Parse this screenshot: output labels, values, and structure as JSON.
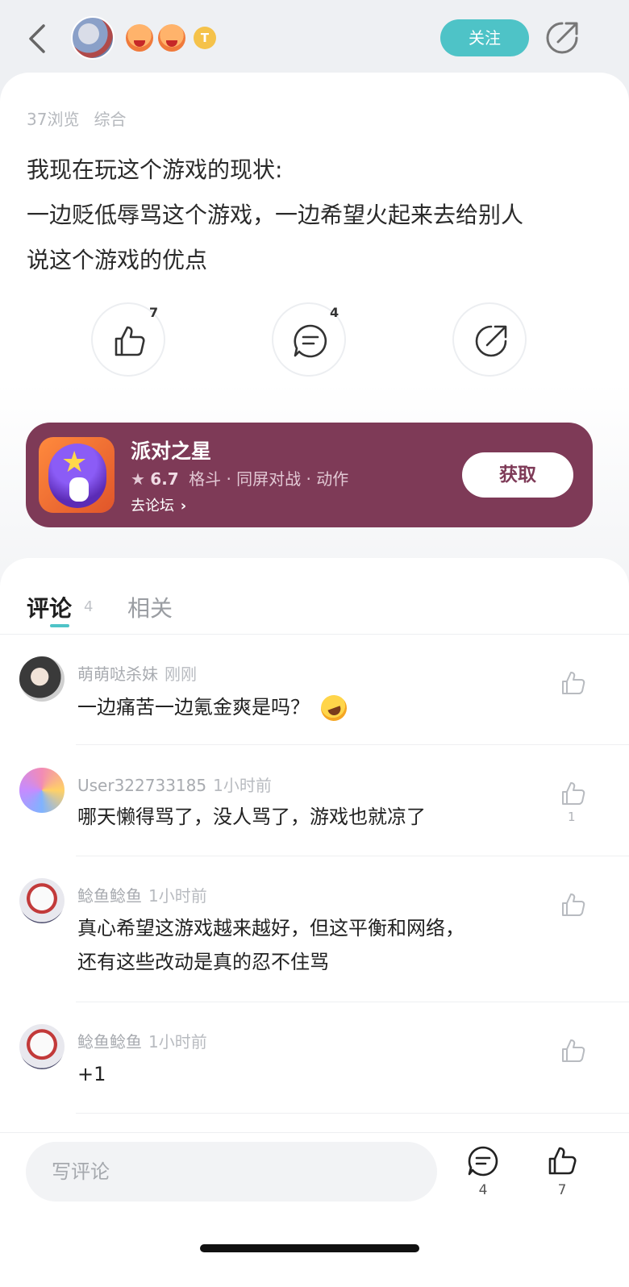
{
  "header": {
    "follow_label": "关注",
    "badge_letter": "T"
  },
  "post": {
    "views": "37浏览",
    "category": "综合",
    "lines": [
      "我现在玩这个游戏的现状:",
      "一边贬低辱骂这个游戏，一边希望火起来去给别人",
      "说这个游戏的优点"
    ],
    "like_count": "7",
    "comment_count": "4"
  },
  "game": {
    "title": "派对之星",
    "rating": "6.7",
    "tags": "格斗 · 同屏对战 · 动作",
    "forum_link": "去论坛",
    "get_label": "获取",
    "color": "#7e3a57"
  },
  "tabs": {
    "comments_label": "评论",
    "comments_count": "4",
    "related_label": "相关",
    "accent": "#4ec3c7"
  },
  "comments": [
    {
      "user": "萌萌哒杀妹",
      "time": "刚刚",
      "text": "一边痛苦一边氪金爽是吗？",
      "likes": ""
    },
    {
      "user": "User322733185",
      "time": "1小时前",
      "text": "哪天懒得骂了，没人骂了，游戏也就凉了",
      "likes": "1"
    },
    {
      "user": "鲶鱼鲶鱼",
      "time": "1小时前",
      "text": "真心希望这游戏越来越好，但这平衡和网络，",
      "text2": "还有这些改动是真的忍不住骂",
      "likes": ""
    },
    {
      "user": "鲶鱼鲶鱼",
      "time": "1小时前",
      "text": "+1",
      "likes": ""
    }
  ],
  "bottom": {
    "input_placeholder": "写评论",
    "comment_count": "4",
    "like_count": "7"
  }
}
